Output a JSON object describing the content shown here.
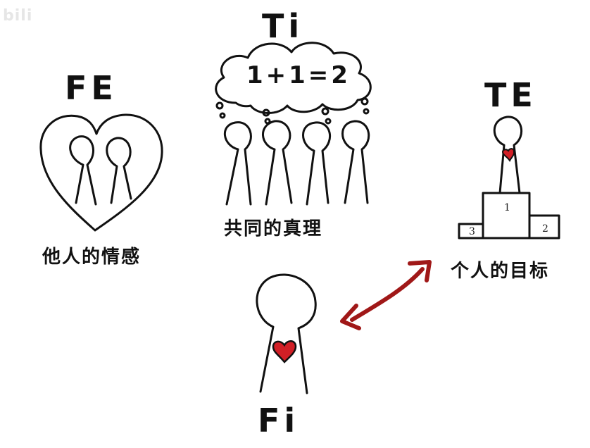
{
  "watermark": "bili",
  "fe": {
    "title": "FE",
    "caption": "他人的情感"
  },
  "ti": {
    "title": "Ti",
    "thought": "1+1=2",
    "caption": "共同的真理"
  },
  "te": {
    "title": "TE",
    "caption": "个人的目标",
    "podium": {
      "first": "1",
      "second": "2",
      "third": "3"
    }
  },
  "fi": {
    "title": "Fi"
  },
  "colors": {
    "ink": "#111111",
    "heart": "#d11f26",
    "arrow": "#a01818"
  }
}
